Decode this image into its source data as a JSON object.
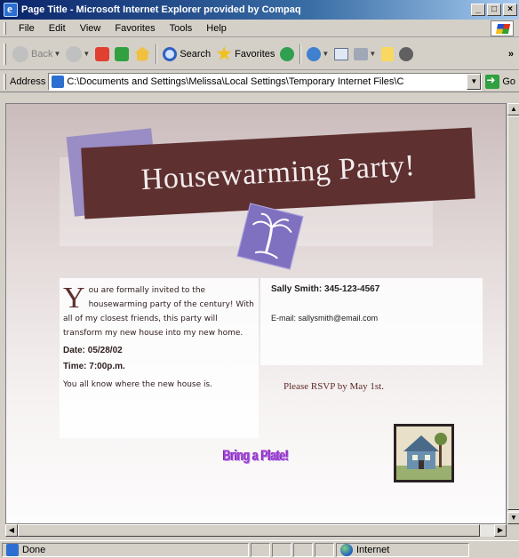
{
  "window": {
    "title": "Page Title - Microsoft Internet Explorer provided by Compaq",
    "min": "_",
    "max": "□",
    "close": "×"
  },
  "menu": [
    "File",
    "Edit",
    "View",
    "Favorites",
    "Tools",
    "Help"
  ],
  "toolbar": {
    "back": "Back",
    "search": "Search",
    "favorites": "Favorites",
    "more": "»"
  },
  "address": {
    "label": "Address",
    "value": "C:\\Documents and Settings\\Melissa\\Local Settings\\Temporary Internet Files\\C",
    "go": "Go"
  },
  "page": {
    "banner_title": "Housewarming Party!",
    "dropcap": "Y",
    "invite": "ou are formally invited to the housewarming party of the century! With all of my closest friends, this party will transform my new house into my new home.",
    "date": "Date: 05/28/02",
    "time": "Time: 7:00p.m.",
    "where": "You all know where the new house is.",
    "contact_name": "Sally Smith: 345-123-4567",
    "contact_email": "E-mail: sallysmith@email.com",
    "rsvp": "Please RSVP by May 1st.",
    "bring": "Bring a Plate!"
  },
  "status": {
    "text": "Done",
    "zone": "Internet"
  },
  "colors": {
    "banner": "#5e3030",
    "accent_purple": "#8070c0",
    "wordart": "#a040d0"
  }
}
